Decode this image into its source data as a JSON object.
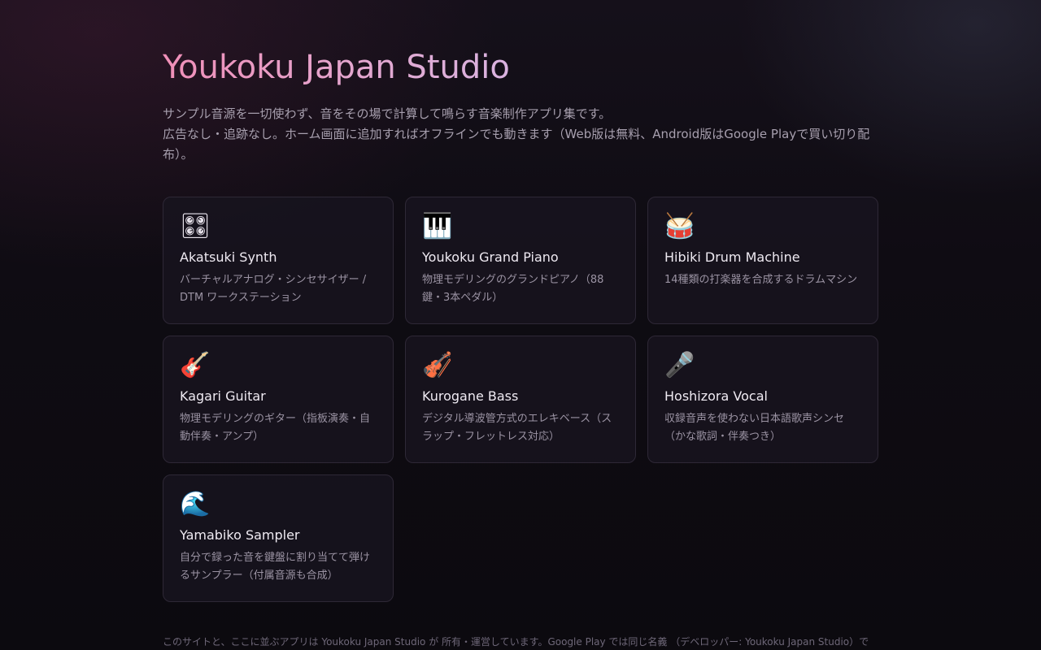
{
  "header": {
    "title": "Youkoku Japan Studio",
    "intro_line1": "サンプル音源を一切使わず、音をその場で計算して鳴らす音楽制作アプリ集です。",
    "intro_line2": "広告なし・追跡なし。ホーム画面に追加すればオフラインでも動きます（Web版は無料、Android版はGoogle Playで買い切り配布）。"
  },
  "apps": [
    {
      "icon": "🎛",
      "icon_name": "control-knobs-icon",
      "title": "Akatsuki Synth",
      "desc": "バーチャルアナログ・シンセサイザー / DTM ワークステーション"
    },
    {
      "icon": "🎹",
      "icon_name": "piano-keyboard-icon",
      "title": "Youkoku Grand Piano",
      "desc": "物理モデリングのグランドピアノ（88鍵・3本ペダル）"
    },
    {
      "icon": "🥁",
      "icon_name": "drum-icon",
      "title": "Hibiki Drum Machine",
      "desc": "14種類の打楽器を合成するドラムマシン"
    },
    {
      "icon": "🎸",
      "icon_name": "guitar-icon",
      "title": "Kagari Guitar",
      "desc": "物理モデリングのギター（指板演奏・自動伴奏・アンプ）"
    },
    {
      "icon": "🎻",
      "icon_name": "violin-icon",
      "title": "Kurogane Bass",
      "desc": "デジタル導波管方式のエレキベース（スラップ・フレットレス対応）"
    },
    {
      "icon": "🎤",
      "icon_name": "microphone-icon",
      "title": "Hoshizora Vocal",
      "desc": "収録音声を使わない日本語歌声シンセ（かな歌詞・伴奏つき）"
    },
    {
      "icon": "🌊",
      "icon_name": "wave-icon",
      "title": "Yamabiko Sampler",
      "desc": "自分で録った音を鍵盤に割り当てて弾けるサンプラー（付属音源も合成）"
    }
  ],
  "footer": {
    "text": "このサイトと、ここに並ぶアプリは Youkoku Japan Studio が 所有・運営しています。Google Play では同じ名義 （デベロッパー: Youkoku Japan Studio）で"
  }
}
